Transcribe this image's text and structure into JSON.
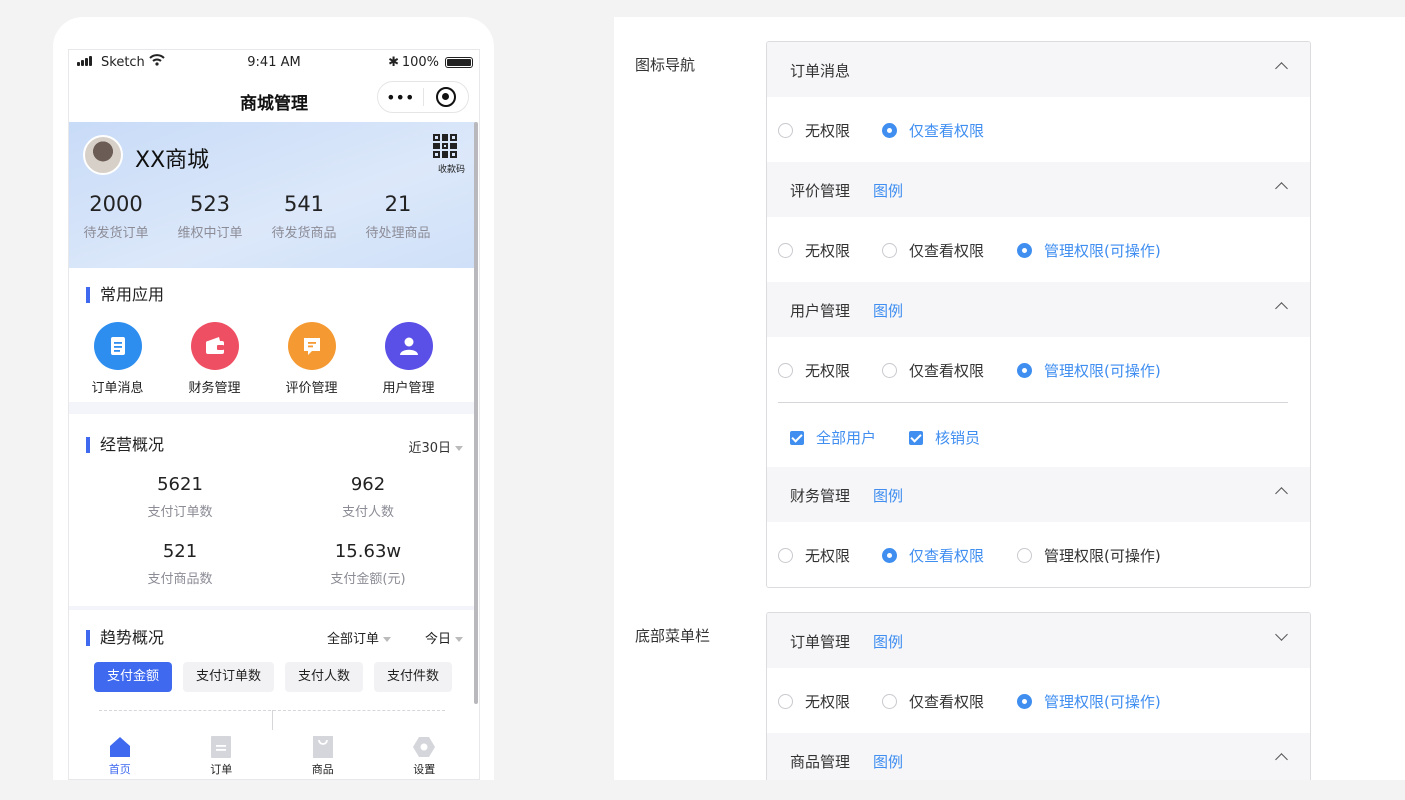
{
  "statusbar": {
    "carrier": "Sketch",
    "time": "9:41 AM",
    "bluetooth": "✱",
    "battery": "100%"
  },
  "navbar": {
    "title": "商城管理",
    "more": "•••"
  },
  "shop": {
    "name": "XX商城",
    "qr_label": "收款码"
  },
  "stats": [
    {
      "value": "2000",
      "label": "待发货订单"
    },
    {
      "value": "523",
      "label": "维权中订单"
    },
    {
      "value": "541",
      "label": "待发货商品"
    },
    {
      "value": "21",
      "label": "待处理商品"
    }
  ],
  "apps": {
    "title": "常用应用",
    "items": [
      {
        "label": "订单消息",
        "color": "#2d8ef0",
        "icon": "clipboard-icon"
      },
      {
        "label": "财务管理",
        "color": "#ef4f63",
        "icon": "wallet-icon"
      },
      {
        "label": "评价管理",
        "color": "#f59a33",
        "icon": "comment-icon"
      },
      {
        "label": "用户管理",
        "color": "#5a4fe6",
        "icon": "user-icon"
      }
    ]
  },
  "business": {
    "title": "经营概况",
    "range": "近30日",
    "cells": [
      {
        "value": "5621",
        "label": "支付订单数"
      },
      {
        "value": "962",
        "label": "支付人数"
      },
      {
        "value": "521",
        "label": "支付商品数"
      },
      {
        "value": "15.63w",
        "label": "支付金额(元)"
      }
    ]
  },
  "trend": {
    "title": "趋势概况",
    "filter": "全部订单",
    "period": "今日",
    "pills": [
      "支付金额",
      "支付订单数",
      "支付人数",
      "支付件数"
    ]
  },
  "tabbar": [
    {
      "label": "首页",
      "icon": "home-icon"
    },
    {
      "label": "订单",
      "icon": "order-icon"
    },
    {
      "label": "商品",
      "icon": "bag-icon"
    },
    {
      "label": "设置",
      "icon": "settings-icon"
    }
  ],
  "perm": {
    "icon_nav_label": "图标导航",
    "bottom_menu_label": "底部菜单栏",
    "legend": "图例",
    "opt_none": "无权限",
    "opt_view": "仅查看权限",
    "opt_manage": "管理权限(可操作)",
    "order_msg": "订单消息",
    "review": "评价管理",
    "user": "用户管理",
    "finance": "财务管理",
    "order_mgmt": "订单管理",
    "goods": "商品管理",
    "all_users": "全部用户",
    "verifier": "核销员"
  }
}
